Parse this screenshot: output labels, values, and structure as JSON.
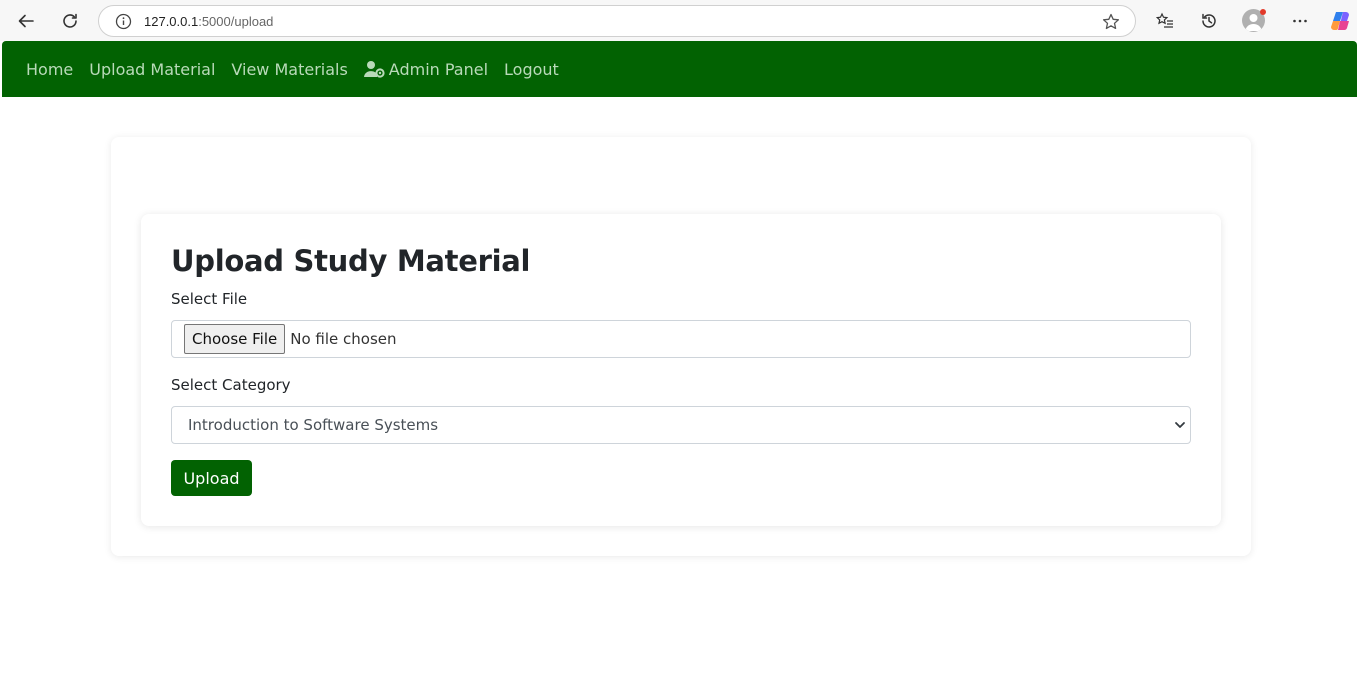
{
  "browser": {
    "url_host": "127.0.0.1",
    "url_path": ":5000/upload"
  },
  "navbar": {
    "items": [
      {
        "label": "Home"
      },
      {
        "label": "Upload Material"
      },
      {
        "label": "View Materials"
      },
      {
        "label": "Admin Panel",
        "icon": "user-cog-icon"
      },
      {
        "label": "Logout"
      }
    ]
  },
  "form": {
    "title": "Upload Study Material",
    "file_label": "Select File",
    "file_button": "Choose File",
    "file_status": "No file chosen",
    "category_label": "Select Category",
    "category_selected": "Introduction to Software Systems",
    "submit_label": "Upload"
  },
  "colors": {
    "brand_green": "#026202",
    "nav_text": "#b9dab9"
  }
}
